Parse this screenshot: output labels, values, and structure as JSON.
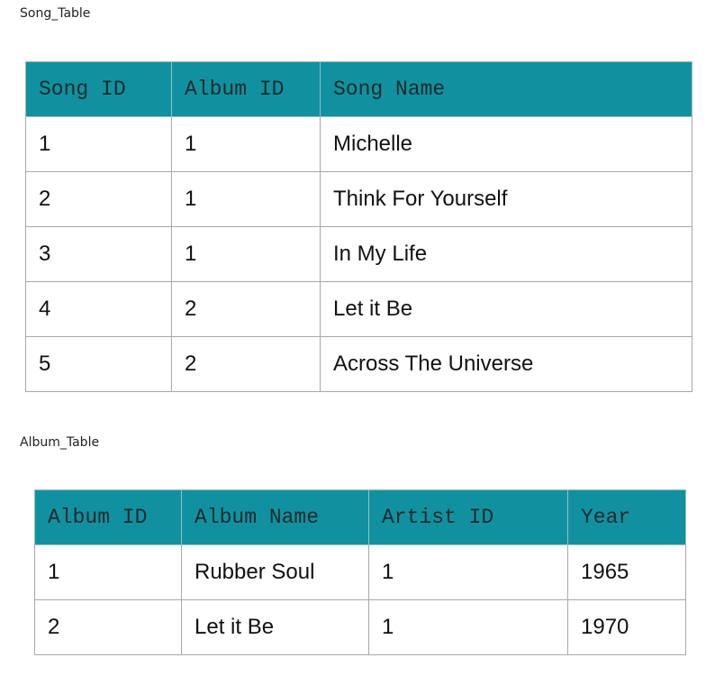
{
  "song_table": {
    "caption": "Song_Table",
    "headers": [
      "Song ID",
      "Album ID",
      "Song Name"
    ],
    "rows": [
      [
        "1",
        "1",
        "Michelle"
      ],
      [
        "2",
        "1",
        "Think For Yourself"
      ],
      [
        "3",
        "1",
        "In My Life"
      ],
      [
        "4",
        "2",
        "Let it Be"
      ],
      [
        "5",
        "2",
        "Across The Universe"
      ]
    ]
  },
  "album_table": {
    "caption": "Album_Table",
    "headers": [
      "Album ID",
      "Album Name",
      "Artist ID",
      "Year"
    ],
    "rows": [
      [
        "1",
        "Rubber Soul",
        "1",
        "1965"
      ],
      [
        "2",
        "Let it Be",
        "1",
        "1970"
      ]
    ]
  },
  "colors": {
    "header_background": "#1191a0",
    "header_text": "#1e2a2c",
    "border": "#a8a8a8"
  }
}
